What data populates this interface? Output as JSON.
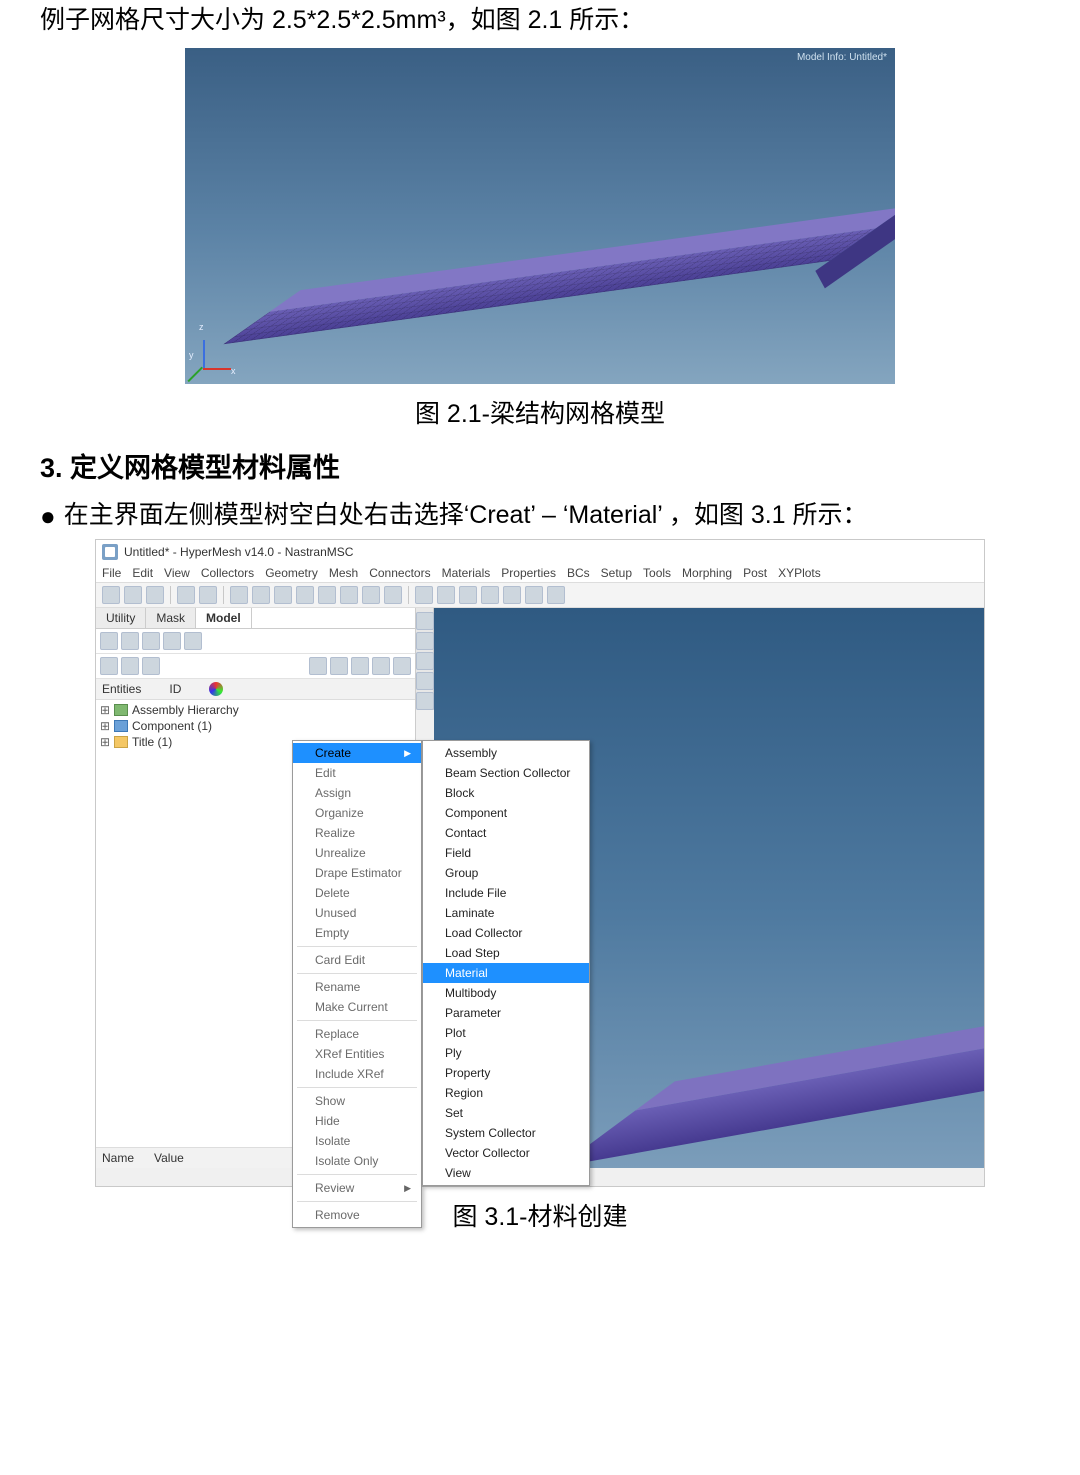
{
  "intro_text": "例子网格尺寸大小为 2.5*2.5*2.5mm³，如图 2.1  所示：",
  "fig21": {
    "caption": "图 2.1-梁结构网格模型",
    "model_info": "Model Info: Untitled*",
    "axes": {
      "x": "x",
      "y": "y",
      "z": "z"
    }
  },
  "section3_heading": "3. 定义网格模型材料属性",
  "bullet_text": "在主界面左侧模型树空白处右击选择‘Creat’  –  ‘Material’ ，如图 3.1 所示：",
  "fig31": {
    "caption": "图 3.1-材料创建",
    "window_title": "Untitled* - HyperMesh v14.0 - NastranMSC",
    "menus": [
      "File",
      "Edit",
      "View",
      "Collectors",
      "Geometry",
      "Mesh",
      "Connectors",
      "Materials",
      "Properties",
      "BCs",
      "Setup",
      "Tools",
      "Morphing",
      "Post",
      "XYPlots"
    ],
    "tabs": [
      "Utility",
      "Mask",
      "Model"
    ],
    "active_tab_index": 2,
    "entities_header": "Entities",
    "id_header": "ID",
    "tree": {
      "items": [
        {
          "label": "Assembly Hierarchy",
          "icon": "asm"
        },
        {
          "label": "Component (1)",
          "icon": "comp"
        },
        {
          "label": "Title (1)",
          "icon": "title"
        }
      ]
    },
    "name_header": "Name",
    "value_header": "Value",
    "context_menu": {
      "groups": [
        [
          "Create",
          "Edit",
          "Assign",
          "Organize",
          "Realize",
          "Unrealize",
          "Drape Estimator",
          "Delete",
          "Unused",
          "Empty"
        ],
        [
          "Card Edit"
        ],
        [
          "Rename",
          "Make Current"
        ],
        [
          "Replace",
          "XRef Entities",
          "Include XRef"
        ],
        [
          "Show",
          "Hide",
          "Isolate",
          "Isolate Only"
        ],
        [
          "Review"
        ],
        [
          "Remove"
        ]
      ],
      "active_index": 0,
      "arrow_items": [
        "Create",
        "Review"
      ]
    },
    "create_submenu": {
      "items": [
        "Assembly",
        "Beam Section Collector",
        "Block",
        "Component",
        "Contact",
        "Field",
        "Group",
        "Include File",
        "Laminate",
        "Load Collector",
        "Load Step",
        "Material",
        "Multibody",
        "Parameter",
        "Plot",
        "Ply",
        "Property",
        "Region",
        "Set",
        "System Collector",
        "Vector Collector",
        "View"
      ],
      "selected_index": 11
    }
  }
}
